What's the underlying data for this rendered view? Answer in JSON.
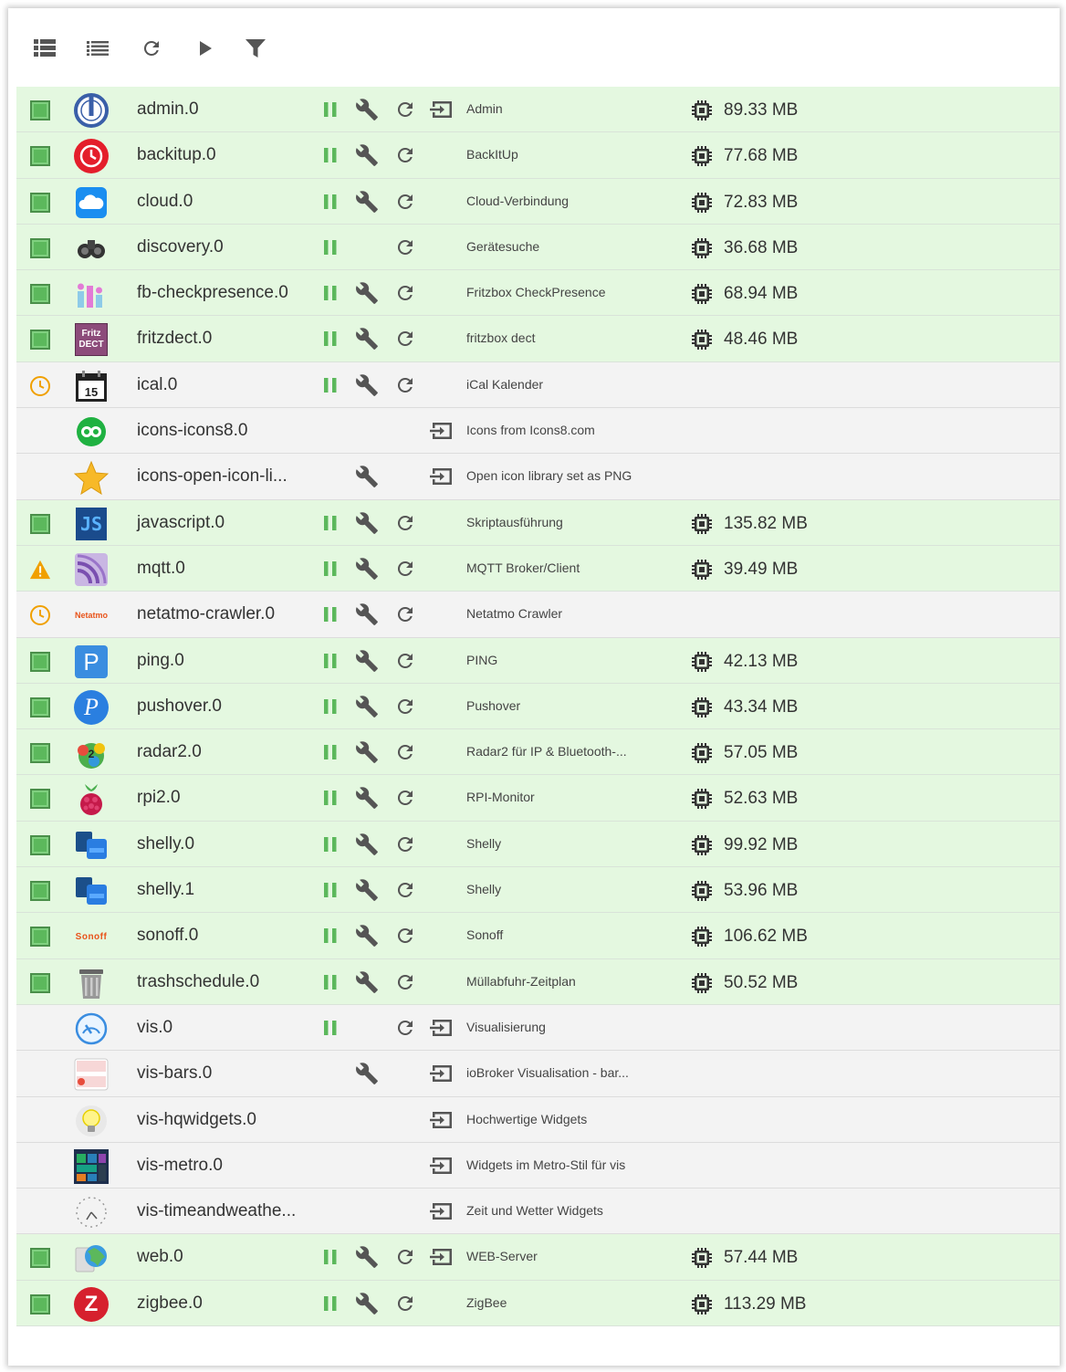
{
  "toolbar": [
    {
      "icon": "view-list-icon"
    },
    {
      "icon": "list-icon"
    },
    {
      "icon": "refresh-icon"
    },
    {
      "icon": "play-icon"
    },
    {
      "icon": "filter-icon"
    }
  ],
  "instances": [
    {
      "name": "admin.0",
      "status": "running",
      "logo": "admin-logo",
      "pause": true,
      "wrench": true,
      "reload": true,
      "open": true,
      "title": "Admin",
      "memory": "89.33 MB"
    },
    {
      "name": "backitup.0",
      "status": "running",
      "logo": "backitup-logo",
      "pause": true,
      "wrench": true,
      "reload": true,
      "open": false,
      "title": "BackItUp",
      "memory": "77.68 MB"
    },
    {
      "name": "cloud.0",
      "status": "running",
      "logo": "cloud-logo",
      "pause": true,
      "wrench": true,
      "reload": true,
      "open": false,
      "title": "Cloud-Verbindung",
      "memory": "72.83 MB"
    },
    {
      "name": "discovery.0",
      "status": "running",
      "logo": "discovery-logo",
      "pause": true,
      "wrench": false,
      "reload": true,
      "open": false,
      "title": "Gerätesuche",
      "memory": "36.68 MB"
    },
    {
      "name": "fb-checkpresence.0",
      "status": "running",
      "logo": "fb-checkpresence-logo",
      "pause": true,
      "wrench": true,
      "reload": true,
      "open": false,
      "title": "Fritzbox CheckPresence",
      "memory": "68.94 MB"
    },
    {
      "name": "fritzdect.0",
      "status": "running",
      "logo": "fritzdect-logo",
      "logo_text": "Fritz DECT",
      "pause": true,
      "wrench": true,
      "reload": true,
      "open": false,
      "title": "fritzbox dect",
      "memory": "48.46 MB"
    },
    {
      "name": "ical.0",
      "status": "scheduled",
      "logo": "ical-logo",
      "logo_text": "15",
      "pause": true,
      "wrench": true,
      "reload": true,
      "open": false,
      "title": "iCal Kalender",
      "memory": ""
    },
    {
      "name": "icons-icons8.0",
      "status": "none",
      "logo": "icons8-logo",
      "pause": false,
      "wrench": false,
      "reload": false,
      "open": true,
      "title": "Icons from Icons8.com",
      "memory": ""
    },
    {
      "name": "icons-open-icon-li...",
      "status": "none",
      "logo": "star-logo",
      "pause": false,
      "wrench": true,
      "reload": false,
      "open": true,
      "title": "Open icon library set as PNG",
      "memory": ""
    },
    {
      "name": "javascript.0",
      "status": "running",
      "logo": "javascript-logo",
      "logo_text": "JS",
      "pause": true,
      "wrench": true,
      "reload": true,
      "open": false,
      "title": "Skriptausführung",
      "memory": "135.82 MB"
    },
    {
      "name": "mqtt.0",
      "status": "warning",
      "logo": "mqtt-logo",
      "pause": true,
      "wrench": true,
      "reload": true,
      "open": false,
      "title": "MQTT Broker/Client",
      "memory": "39.49 MB"
    },
    {
      "name": "netatmo-crawler.0",
      "status": "scheduled",
      "logo": "netatmo-logo",
      "logo_text": "Netatmo",
      "pause": true,
      "wrench": true,
      "reload": true,
      "open": false,
      "title": "Netatmo Crawler",
      "memory": ""
    },
    {
      "name": "ping.0",
      "status": "running",
      "logo": "ping-logo",
      "logo_text": "P",
      "pause": true,
      "wrench": true,
      "reload": true,
      "open": false,
      "title": "PING",
      "memory": "42.13 MB"
    },
    {
      "name": "pushover.0",
      "status": "running",
      "logo": "pushover-logo",
      "logo_text": "P",
      "pause": true,
      "wrench": true,
      "reload": true,
      "open": false,
      "title": "Pushover",
      "memory": "43.34 MB"
    },
    {
      "name": "radar2.0",
      "status": "running",
      "logo": "radar2-logo",
      "pause": true,
      "wrench": true,
      "reload": true,
      "open": false,
      "title": "Radar2 für IP & Bluetooth-...",
      "memory": "57.05 MB"
    },
    {
      "name": "rpi2.0",
      "status": "running",
      "logo": "raspberry-logo",
      "pause": true,
      "wrench": true,
      "reload": true,
      "open": false,
      "title": "RPI-Monitor",
      "memory": "52.63 MB"
    },
    {
      "name": "shelly.0",
      "status": "running",
      "logo": "shelly-logo",
      "pause": true,
      "wrench": true,
      "reload": true,
      "open": false,
      "title": "Shelly",
      "memory": "99.92 MB"
    },
    {
      "name": "shelly.1",
      "status": "running",
      "logo": "shelly-logo",
      "pause": true,
      "wrench": true,
      "reload": true,
      "open": false,
      "title": "Shelly",
      "memory": "53.96 MB"
    },
    {
      "name": "sonoff.0",
      "status": "running",
      "logo": "sonoff-logo",
      "logo_text": "Sonoff",
      "pause": true,
      "wrench": true,
      "reload": true,
      "open": false,
      "title": "Sonoff",
      "memory": "106.62 MB"
    },
    {
      "name": "trashschedule.0",
      "status": "running",
      "logo": "trash-logo",
      "pause": true,
      "wrench": true,
      "reload": true,
      "open": false,
      "title": "Müllabfuhr-Zeitplan",
      "memory": "50.52 MB"
    },
    {
      "name": "vis.0",
      "status": "none",
      "logo": "vis-logo",
      "pause": true,
      "wrench": false,
      "reload": true,
      "open": true,
      "title": "Visualisierung",
      "memory": ""
    },
    {
      "name": "vis-bars.0",
      "status": "none",
      "logo": "vis-bars-logo",
      "pause": false,
      "wrench": true,
      "reload": false,
      "open": true,
      "title": "ioBroker Visualisation - bar...",
      "memory": ""
    },
    {
      "name": "vis-hqwidgets.0",
      "status": "none",
      "logo": "bulb-logo",
      "pause": false,
      "wrench": false,
      "reload": false,
      "open": true,
      "title": "Hochwertige Widgets",
      "memory": ""
    },
    {
      "name": "vis-metro.0",
      "status": "none",
      "logo": "metro-logo",
      "pause": false,
      "wrench": false,
      "reload": false,
      "open": true,
      "title": "Widgets im Metro-Stil für vis",
      "memory": ""
    },
    {
      "name": "vis-timeandweathe...",
      "status": "none",
      "logo": "clock-logo",
      "pause": false,
      "wrench": false,
      "reload": false,
      "open": true,
      "title": "Zeit und Wetter Widgets",
      "memory": ""
    },
    {
      "name": "web.0",
      "status": "running",
      "logo": "web-logo",
      "pause": true,
      "wrench": true,
      "reload": true,
      "open": true,
      "title": "WEB-Server",
      "memory": "57.44 MB"
    },
    {
      "name": "zigbee.0",
      "status": "running",
      "logo": "zigbee-logo",
      "logo_text": "Z",
      "pause": true,
      "wrench": true,
      "reload": true,
      "open": false,
      "title": "ZigBee",
      "memory": "113.29 MB"
    }
  ],
  "colors": {
    "running_row": "#e4f8e0",
    "idle_row": "#f3f3f3",
    "pause_green": "#5cb85c",
    "warning": "#f0a000",
    "scheduled": "#f0a000",
    "icon_gray": "#555555"
  }
}
